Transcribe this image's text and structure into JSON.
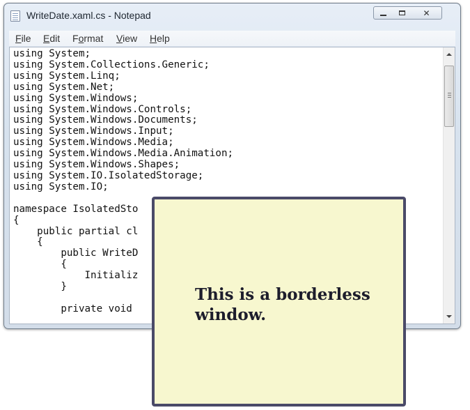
{
  "notepad": {
    "title": "WriteDate.xaml.cs - Notepad",
    "controls": {
      "minimize_icon": "minimize-icon",
      "maximize_icon": "maximize-icon",
      "close_glyph": "✕"
    },
    "menu": [
      {
        "mnemonic": "F",
        "rest": "ile"
      },
      {
        "mnemonic": "E",
        "rest": "dit"
      },
      {
        "mnemonic": "o",
        "rest": "rmat",
        "pre": "F"
      },
      {
        "mnemonic": "V",
        "rest": "iew"
      },
      {
        "mnemonic": "H",
        "rest": "elp"
      }
    ],
    "editor_text": "using System;\nusing System.Collections.Generic;\nusing System.Linq;\nusing System.Net;\nusing System.Windows;\nusing System.Windows.Controls;\nusing System.Windows.Documents;\nusing System.Windows.Input;\nusing System.Windows.Media;\nusing System.Windows.Media.Animation;\nusing System.Windows.Shapes;\nusing System.IO.IsolatedStorage;\nusing System.IO;\n\nnamespace IsolatedSto\n{\n    public partial cl\n    {\n        public WriteD\n        {\n            Initializ\n        }\n\n        private void"
  },
  "borderless_window": {
    "text": "This is a borderless window."
  },
  "colors": {
    "borderless_bg": "#f7f7cf",
    "borderless_border": "#4a4a68"
  }
}
